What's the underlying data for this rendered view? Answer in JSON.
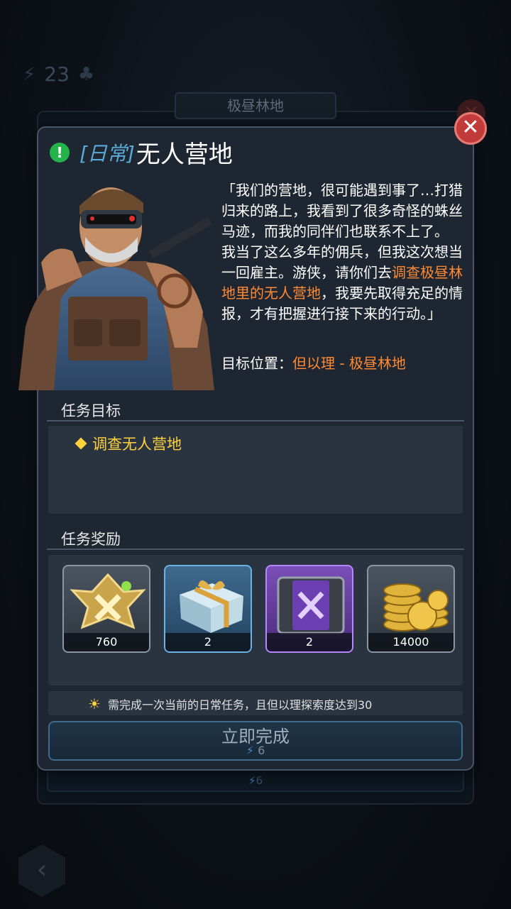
{
  "background": {
    "hud_value": "23",
    "tab_label": "极昼林地",
    "cost_value": "6"
  },
  "dialog": {
    "title_tag": "[日常]",
    "title": "无人营地",
    "quote_para1": "「我们的营地，很可能遇到事了…打猎归来的路上，我看到了很多奇怪的蛛丝马迹，而我的同伴们也联系不上了。",
    "quote_para2_a": "我当了这么多年的佣兵，但我这次想当一回雇主。游侠，请你们去",
    "quote_para2_hl": "调查极昼林地里的无人营地",
    "quote_para2_b": "，我要先取得充足的情报，才有把握进行接下来的行动。」",
    "target_label": "目标位置：",
    "target_value": "但以理 - 极昼林地",
    "objectives_title": "任务目标",
    "objective_1": "调查无人营地",
    "rewards_title": "任务奖励",
    "rewards": [
      {
        "icon": "rank-emblem-icon",
        "count": "760",
        "rarity": "gray"
      },
      {
        "icon": "gift-box-icon",
        "count": "2",
        "rarity": "blue"
      },
      {
        "icon": "purple-crate-icon",
        "count": "2",
        "rarity": "purple"
      },
      {
        "icon": "gold-coins-icon",
        "count": "14000",
        "rarity": "gray"
      }
    ],
    "hint": "需完成一次当前的日常任务，且但以理探索度达到30",
    "complete_label": "立即完成",
    "complete_cost": "6"
  },
  "colors": {
    "highlight_orange": "#ff8a33",
    "objective_yellow": "#ffd23d",
    "tag_blue": "#5aaad8",
    "close_red": "#c23b3b"
  }
}
